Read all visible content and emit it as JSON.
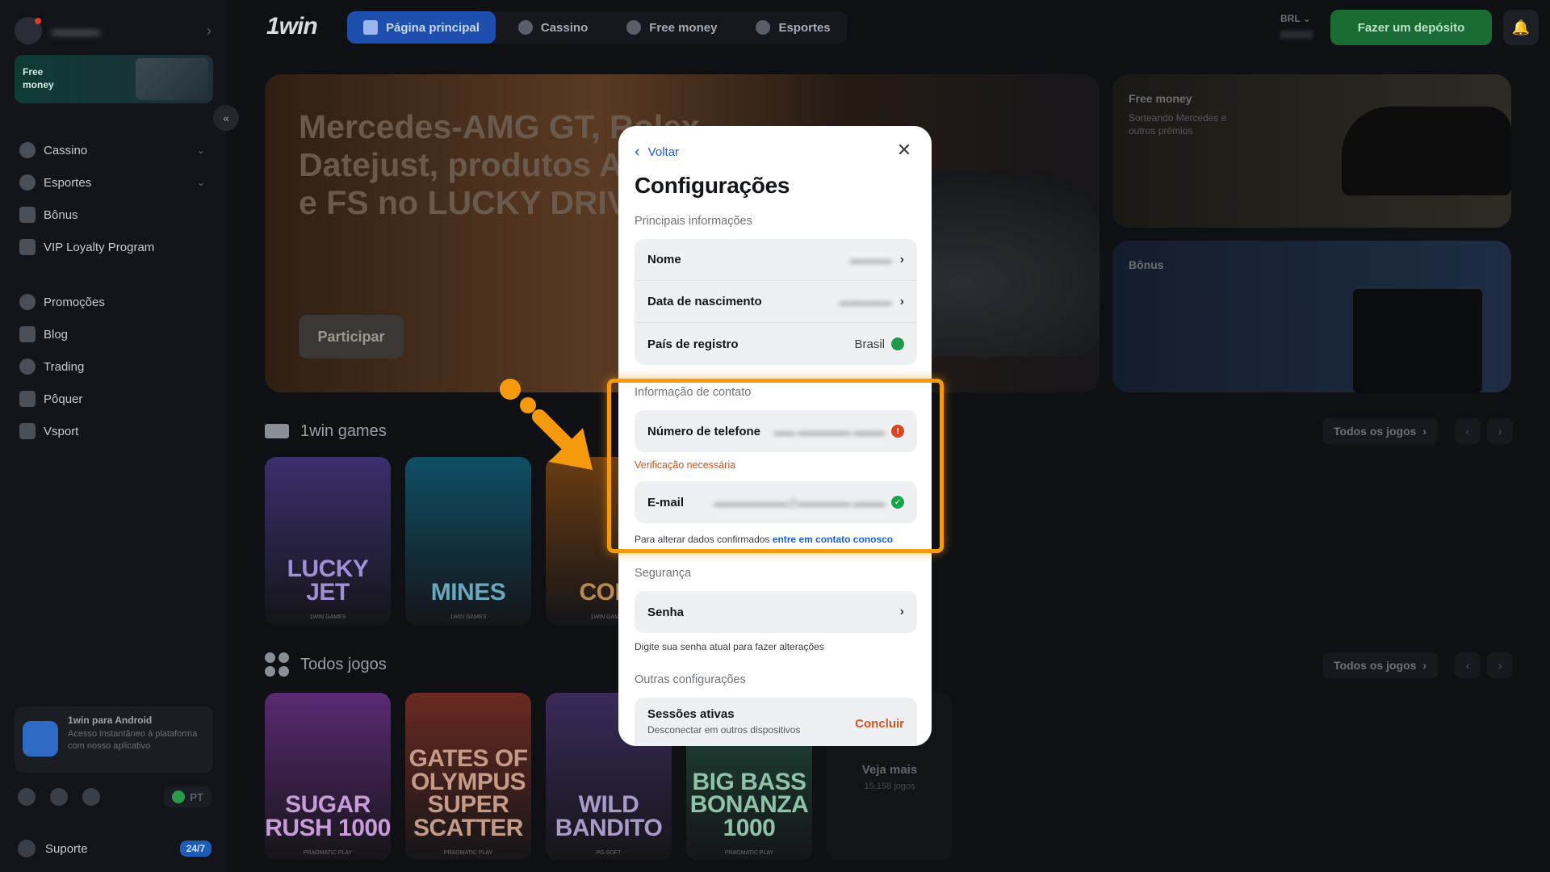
{
  "sidebar": {
    "free_banner": "Free money",
    "items_top": [
      {
        "label": "Cassino",
        "icon": "cassino-icon",
        "expandable": true
      },
      {
        "label": "Esportes",
        "icon": "esportes-icon",
        "expandable": true
      },
      {
        "label": "Bônus",
        "icon": "bonus-icon",
        "expandable": false
      },
      {
        "label": "VIP Loyalty Program",
        "icon": "trophy-icon",
        "expandable": false
      }
    ],
    "items_bottom": [
      {
        "label": "Promoções",
        "icon": "promo-icon"
      },
      {
        "label": "Blog",
        "icon": "blog-icon"
      },
      {
        "label": "Trading",
        "icon": "trading-icon"
      },
      {
        "label": "Pôquer",
        "icon": "poker-icon"
      },
      {
        "label": "Vsport",
        "icon": "vsport-icon"
      }
    ],
    "android": {
      "title": "1win para Android",
      "desc": "Acesso instantâneo à plataforma com nosso aplicativo"
    },
    "language": "PT",
    "support_label": "Suporte",
    "support_badge": "24/7"
  },
  "header": {
    "logo": "1win",
    "nav": [
      {
        "label": "Página principal",
        "icon": "home-icon",
        "active": true
      },
      {
        "label": "Cassino",
        "icon": "casino-chip-icon",
        "active": false
      },
      {
        "label": "Free money",
        "icon": "coin-icon",
        "active": false
      },
      {
        "label": "Esportes",
        "icon": "ball-icon",
        "active": false
      }
    ],
    "currency": "BRL",
    "deposit_label": "Fazer um depósito"
  },
  "hero": {
    "title": "Mercedes-AMG GT, Rolex Datejust, produtos Apple e FS no LUCKY DRIVE",
    "cta": "Participar"
  },
  "promos": [
    {
      "title": "Free money",
      "subtitle": "Sorteando Mercedes e outros prêmios"
    },
    {
      "title": "Bônus",
      "subtitle": ""
    }
  ],
  "sections": {
    "games_title": "1win games",
    "all_title": "Todos jogos",
    "all_games_label": "Todos os jogos"
  },
  "cards_row1": [
    {
      "name": "LUCKY JET",
      "provider": "1WIN GAMES",
      "bg": "#3b2f6e",
      "fg": "#9f8fd6"
    },
    {
      "name": "MINES",
      "provider": "1WIN GAMES",
      "bg": "#0f4f66",
      "fg": "#6aa7bd"
    },
    {
      "name": "COIN",
      "provider": "1WIN GAMES",
      "bg": "#6a3d12",
      "fg": "#b88a52"
    }
  ],
  "cards_row2": [
    {
      "name": "SUGAR RUSH 1000",
      "provider": "PRAGMATIC PLAY",
      "bg": "#5b2a73",
      "fg": "#c89bd9"
    },
    {
      "name": "GATES OF OLYMPUS SUPER SCATTER",
      "provider": "PRAGMATIC PLAY",
      "bg": "#6a2a22",
      "fg": "#c59a86"
    },
    {
      "name": "WILD BANDITO",
      "provider": "PG SOFT",
      "bg": "#3a2a5a",
      "fg": "#a99ac7"
    },
    {
      "name": "BIG BASS BONANZA 1000",
      "provider": "PRAGMATIC PLAY",
      "bg": "#1f4a3a",
      "fg": "#8fc2a8"
    }
  ],
  "veja": {
    "label": "Veja mais",
    "count": "15.158 jogos"
  },
  "modal": {
    "back_label": "Voltar",
    "title": "Configurações",
    "main_section": "Principais informações",
    "main_rows": [
      {
        "label": "Nome",
        "value": "hidden",
        "blurred": true,
        "arrow": true
      },
      {
        "label": "Data de nascimento",
        "value": "hidden",
        "blurred": true,
        "arrow": true
      },
      {
        "label": "País de registro",
        "value": "Brasil",
        "blurred": false,
        "arrow": false
      }
    ],
    "contact_section": "Informação de contato",
    "phone_label": "Número de telefone",
    "phone_value": "hidden",
    "verification_text": "Verificação necessária",
    "email_label": "E-mail",
    "email_value": "hidden",
    "contact_note_prefix": "Para alterar dados confirmados",
    "contact_note_link": "entre em contato conosco",
    "security_section": "Segurança",
    "password_label": "Senha",
    "password_note": "Digite sua senha atual para fazer alterações",
    "other_section": "Outras configurações",
    "sessions_title": "Sessões ativas",
    "sessions_subtitle": "Desconectar em outros dispositivos",
    "sessions_action": "Concluir"
  },
  "colors": {
    "accent_blue": "#1a5fd6",
    "warning": "#d9531c",
    "success": "#1aa54a",
    "highlight": "#f59a0c"
  }
}
